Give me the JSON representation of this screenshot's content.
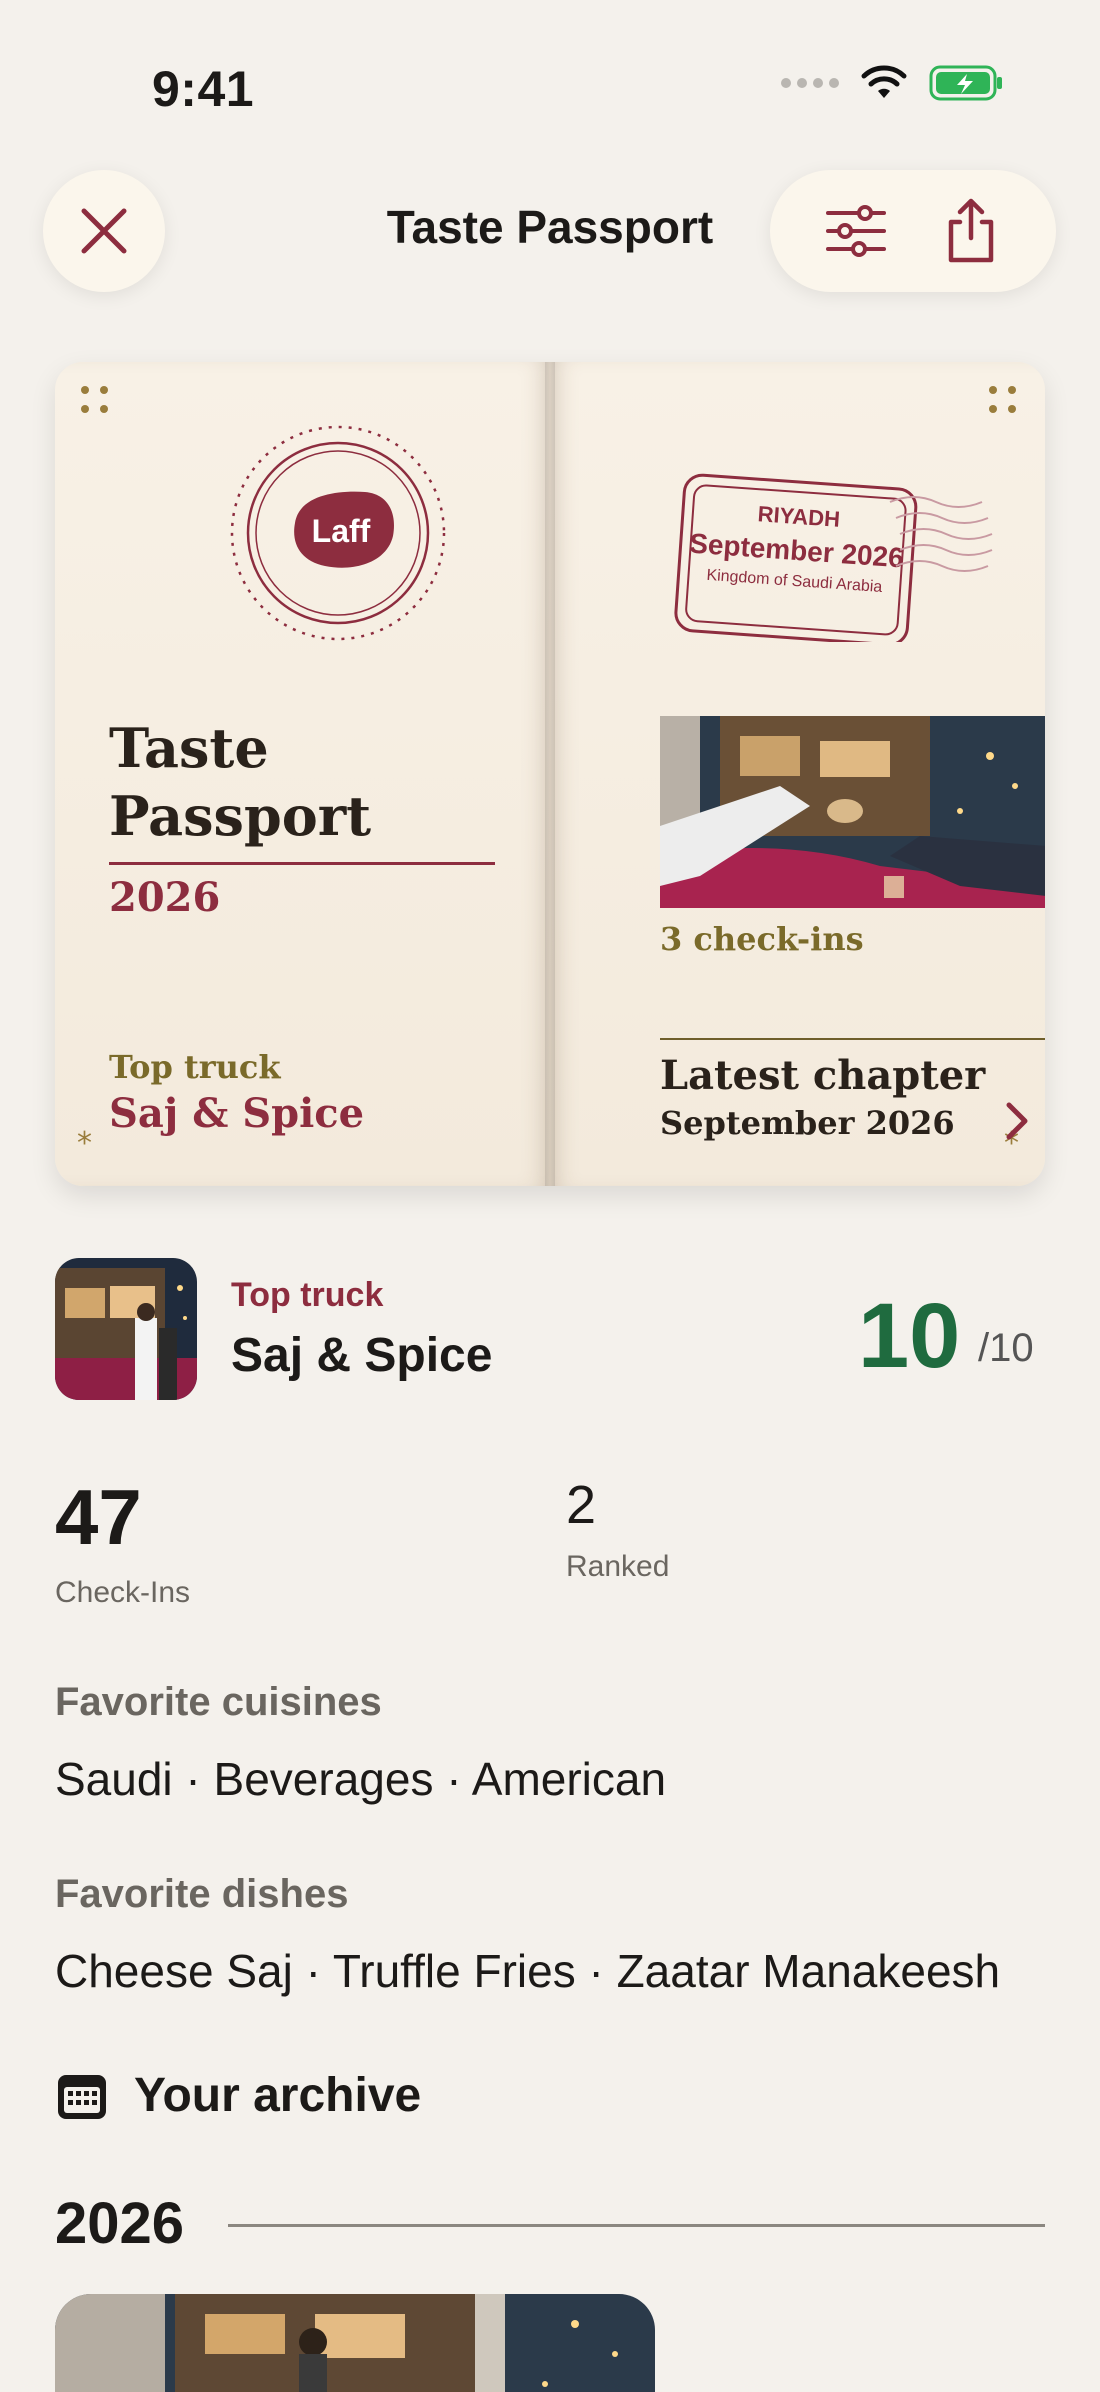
{
  "status": {
    "time": "9:41"
  },
  "header": {
    "title": "Taste Passport"
  },
  "passport": {
    "logo_text": "Laff",
    "title": "Taste Passport",
    "year": "2026",
    "top_truck_label": "Top truck",
    "top_truck_name": "Saj & Spice",
    "stamp": {
      "city": "RIYADH",
      "date": "September 2026",
      "country": "Kingdom of Saudi Arabia"
    },
    "checkins_text": "3 check-ins",
    "latest_chapter_label": "Latest chapter",
    "latest_chapter_date": "September 2026"
  },
  "top_truck": {
    "label": "Top truck",
    "name": "Saj & Spice",
    "score": "10",
    "score_max": "/10"
  },
  "stats": [
    {
      "value": "47",
      "label": "Check-Ins"
    },
    {
      "value": "2",
      "label": "Ranked"
    }
  ],
  "favorites": {
    "cuisines_label": "Favorite cuisines",
    "cuisines_value": "Saudi · Beverages · American",
    "dishes_label": "Favorite dishes",
    "dishes_value": "Cheese Saj · Truffle Fries · Zaatar Manakeesh"
  },
  "archive": {
    "title": "Your archive",
    "year": "2026"
  },
  "colors": {
    "accent": "#8d2d3f",
    "score": "#1f6b3f",
    "gold": "#7a6a2a",
    "background": "#f4f1ec"
  },
  "icons": {
    "close": "close-icon",
    "filter": "sliders-icon",
    "share": "share-icon",
    "calendar": "calendar-icon",
    "chevron": "chevron-right-icon"
  }
}
